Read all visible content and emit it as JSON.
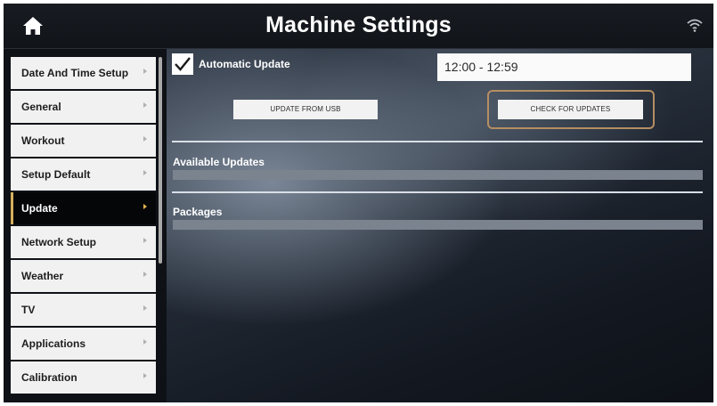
{
  "header": {
    "title": "Machine Settings",
    "home_icon": "home-icon",
    "status_icon": "wifi-icon"
  },
  "sidebar": {
    "items": [
      {
        "label": "Date And Time Setup",
        "active": false
      },
      {
        "label": "General",
        "active": false
      },
      {
        "label": "Workout",
        "active": false
      },
      {
        "label": "Setup Default",
        "active": false
      },
      {
        "label": "Update",
        "active": true
      },
      {
        "label": "Network Setup",
        "active": false
      },
      {
        "label": "Weather",
        "active": false
      },
      {
        "label": "TV",
        "active": false
      },
      {
        "label": "Applications",
        "active": false
      },
      {
        "label": "Calibration",
        "active": false
      }
    ]
  },
  "update": {
    "automatic_update_label": "Automatic Update",
    "automatic_update_checked": true,
    "time_window_value": "12:00 - 12:59",
    "update_from_usb_label": "UPDATE FROM USB",
    "check_for_updates_label": "CHECK FOR UPDATES",
    "available_updates_label": "Available Updates",
    "packages_label": "Packages"
  },
  "colors": {
    "active_accent": "#d6b05d",
    "focus_ring": "#b58e62",
    "sidebar_item_bg": "#f1f1f1",
    "active_item_bg": "#050608"
  }
}
